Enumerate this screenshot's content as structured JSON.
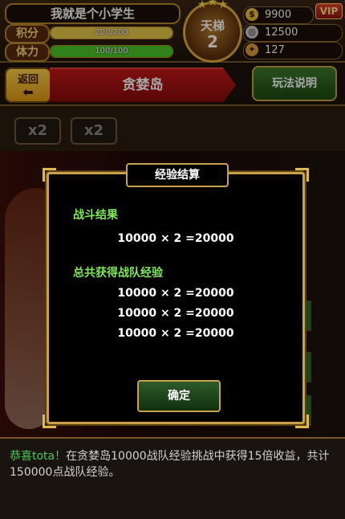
{
  "player": {
    "name": "我就是个小学生",
    "score_label": "积分",
    "score_text": "200/200",
    "score_fraction": 1.0,
    "stamina_label": "体力",
    "stamina_text": "100/100",
    "stamina_fraction": 1.0
  },
  "rank": {
    "title": "天梯",
    "number": "2"
  },
  "currency": {
    "gold": "9900",
    "silver": "12500",
    "energy": "127",
    "vip_label": "VIP"
  },
  "header": {
    "back_label": "返回",
    "location": "贪婪岛",
    "rules_label": "玩法说明"
  },
  "multipliers": [
    "x2",
    "x2"
  ],
  "modal": {
    "title": "经验结算",
    "battle_result_label": "战斗结果",
    "battle_calc": "10000 × 2 =20000",
    "total_label": "总共获得战队经验",
    "total_calcs": [
      "10000 × 2 =20000",
      "10000 × 2 =20000",
      "10000 × 2 =20000"
    ],
    "confirm_label": "确定"
  },
  "message": {
    "highlight": "恭喜tota！",
    "body": "在贪婪岛10000战队经验挑战中获得15倍收益，共计150000点战队经验。"
  },
  "colors": {
    "score_bar": "#e8c84a",
    "stamina_bar": "#4ac82a",
    "accent_green": "#7fe85a",
    "gold_border": "#c8a24a"
  }
}
